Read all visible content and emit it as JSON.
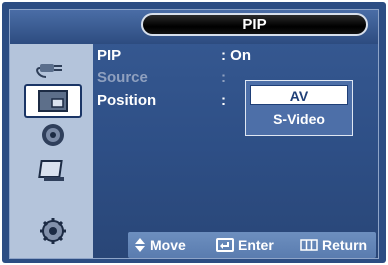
{
  "header": {
    "title": "PIP"
  },
  "sidebar": {
    "items": [
      {
        "icon": "plug-icon",
        "active": false
      },
      {
        "icon": "pip-picture-icon",
        "active": true
      },
      {
        "icon": "speaker-icon",
        "active": false
      },
      {
        "icon": "picture-frame-icon",
        "active": false
      },
      {
        "icon": "gear-icon",
        "active": false
      }
    ]
  },
  "menu": {
    "rows": [
      {
        "label": "PIP",
        "value": ": On",
        "dimmed": false
      },
      {
        "label": "Source",
        "value": ":",
        "dimmed": true
      },
      {
        "label": "Position",
        "value": ":",
        "dimmed": false
      }
    ]
  },
  "dropdown": {
    "options": [
      {
        "label": "AV",
        "selected": true
      },
      {
        "label": "S-Video",
        "selected": false
      }
    ]
  },
  "footer": {
    "move": "Move",
    "enter": "Enter",
    "return": "Return"
  },
  "colors": {
    "panel": "#2c4d83",
    "sidebar": "#b4c4db",
    "title_pill": "#000000",
    "dim_text": "#8fa0bf"
  }
}
